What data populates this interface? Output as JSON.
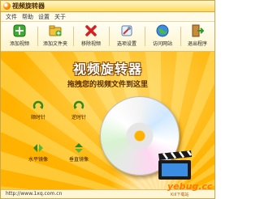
{
  "window": {
    "title": "视频旋转器"
  },
  "menu": {
    "items": [
      "文件",
      "帮助",
      "设置",
      "关于"
    ]
  },
  "toolbar": {
    "buttons": [
      {
        "label": "添加视频",
        "icon": "add-video-icon"
      },
      {
        "label": "添加文件夹",
        "icon": "add-folder-icon"
      },
      {
        "label": "移除视频",
        "icon": "remove-video-icon"
      },
      {
        "label": "选项设置",
        "icon": "settings-icon"
      },
      {
        "label": "访问网站",
        "icon": "globe-icon"
      },
      {
        "label": "退出程序",
        "icon": "exit-icon"
      }
    ]
  },
  "main": {
    "headline": "视频旋转器",
    "subline": "拖拽您的视频文件到这里",
    "actions": [
      {
        "label": "顺时针",
        "icon": "rotate-clockwise-icon"
      },
      {
        "label": "逆时针",
        "icon": "rotate-counterclockwise-icon"
      },
      {
        "label": "水平镜像",
        "icon": "horizontal-mirror-icon"
      },
      {
        "label": "垂直镜像",
        "icon": "vertical-mirror-icon"
      }
    ]
  },
  "status": {
    "url": "http://www.1xq.com.cn"
  },
  "watermark": {
    "main": "yebug.cc",
    "sub": "Kill下载站"
  },
  "colors": {
    "accent": "#ffb300",
    "toolbar_bg": "#fff4c8",
    "headline_outline": "#7a3f00"
  }
}
